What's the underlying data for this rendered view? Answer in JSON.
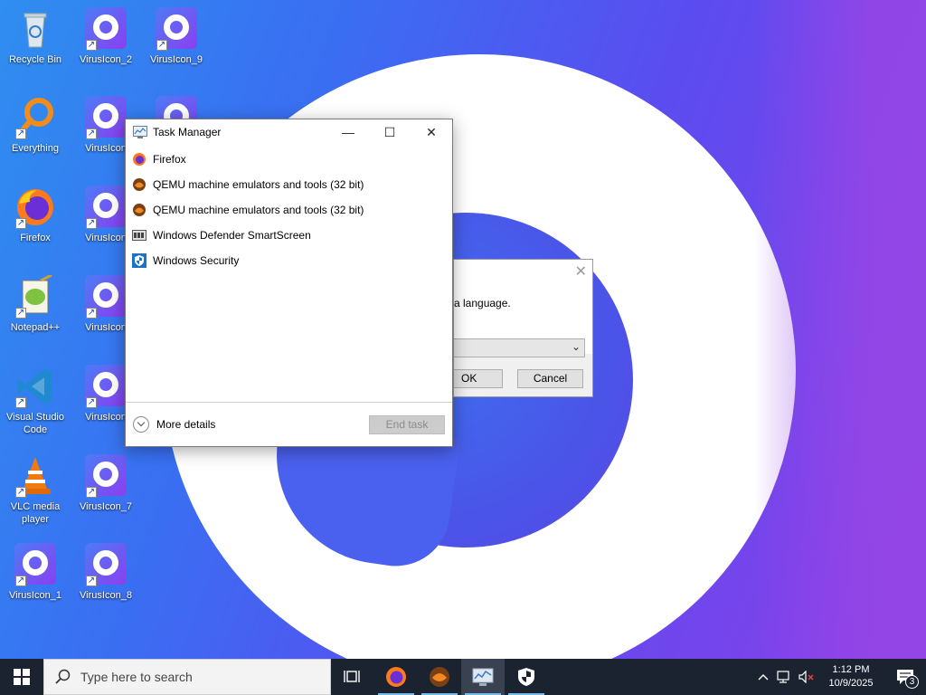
{
  "desktop": {
    "icons": [
      {
        "label": "Recycle Bin",
        "icon": "recycle-bin-icon"
      },
      {
        "label": "VirusIcon_2",
        "icon": "virusicon-icon"
      },
      {
        "label": "VirusIcon_9",
        "icon": "virusicon-icon"
      },
      {
        "label": "Everything",
        "icon": "everything-search-icon"
      },
      {
        "label": "VirusIcon",
        "icon": "virusicon-icon"
      },
      {
        "label": "Firefox",
        "icon": "firefox-icon"
      },
      {
        "label": "VirusIcon",
        "icon": "virusicon-icon"
      },
      {
        "label": "Notepad++",
        "icon": "notepadpp-icon"
      },
      {
        "label": "VirusIcon",
        "icon": "virusicon-icon"
      },
      {
        "label": "Visual Studio Code",
        "icon": "vscode-icon"
      },
      {
        "label": "VirusIcon",
        "icon": "virusicon-icon"
      },
      {
        "label": "VLC media player",
        "icon": "vlc-icon"
      },
      {
        "label": "VirusIcon_7",
        "icon": "virusicon-icon"
      },
      {
        "label": "VirusIcon_1",
        "icon": "virusicon-icon"
      },
      {
        "label": "VirusIcon_8",
        "icon": "virusicon-icon"
      }
    ]
  },
  "task_manager": {
    "title": "Task Manager",
    "processes": [
      {
        "name": "Firefox",
        "icon": "firefox-icon"
      },
      {
        "name": "QEMU machine emulators and tools (32 bit)",
        "icon": "qemu-icon"
      },
      {
        "name": "QEMU machine emulators and tools (32 bit)",
        "icon": "qemu-icon"
      },
      {
        "name": "Windows Defender SmartScreen",
        "icon": "smartscreen-icon"
      },
      {
        "name": "Windows Security",
        "icon": "windows-security-icon"
      }
    ],
    "more_details": "More details",
    "end_task": "End task"
  },
  "dialog": {
    "text": "a language.",
    "ok": "OK",
    "cancel": "Cancel"
  },
  "taskbar": {
    "search_placeholder": "Type here to search",
    "time": "1:12 PM",
    "date": "10/9/2025",
    "notification_count": "3"
  },
  "colors": {
    "taskbar_bg": "#1c2330",
    "accent": "#76b9ed"
  }
}
